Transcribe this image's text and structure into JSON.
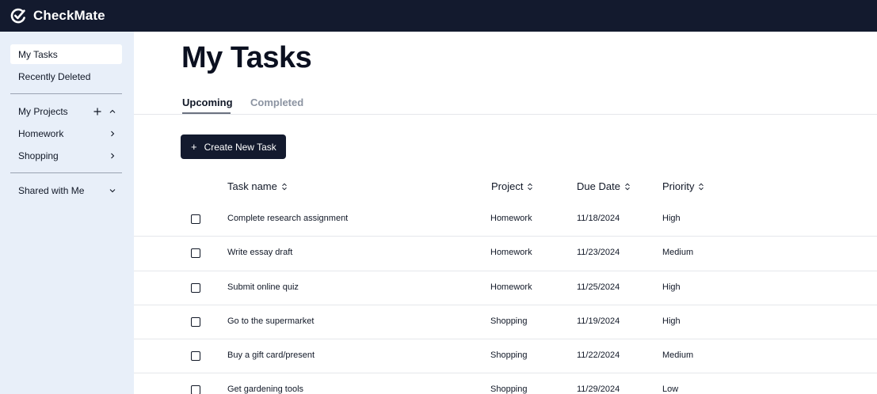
{
  "app": {
    "title": "CheckMate",
    "logo_icon": "check-logo-icon"
  },
  "sidebar": {
    "my_tasks": "My Tasks",
    "recently_deleted": "Recently Deleted",
    "my_projects": "My Projects",
    "projects": [
      {
        "label": "Homework"
      },
      {
        "label": "Shopping"
      }
    ],
    "shared_with_me": "Shared with Me"
  },
  "main": {
    "title": "My Tasks",
    "tabs": [
      {
        "label": "Upcoming",
        "active": true
      },
      {
        "label": "Completed",
        "active": false
      }
    ],
    "create_button": {
      "icon": "+",
      "label": "Create New Task"
    },
    "columns": [
      "Task name",
      "Project",
      "Due Date",
      "Priority"
    ],
    "rows": [
      {
        "task": "Complete research assignment",
        "project": "Homework",
        "due": "11/18/2024",
        "priority": "High"
      },
      {
        "task": "Write essay draft",
        "project": "Homework",
        "due": "11/23/2024",
        "priority": "Medium"
      },
      {
        "task": "Submit online quiz",
        "project": "Homework",
        "due": "11/25/2024",
        "priority": "High"
      },
      {
        "task": "Go to the supermarket",
        "project": "Shopping",
        "due": "11/19/2024",
        "priority": "High"
      },
      {
        "task": "Buy a gift card/present",
        "project": "Shopping",
        "due": "11/22/2024",
        "priority": "Medium"
      },
      {
        "task": "Get gardening tools",
        "project": "Shopping",
        "due": "11/29/2024",
        "priority": "Low"
      }
    ]
  },
  "colors": {
    "topbar": "#131a2e",
    "sidebar": "#e8eff9",
    "button": "#131a2e"
  }
}
